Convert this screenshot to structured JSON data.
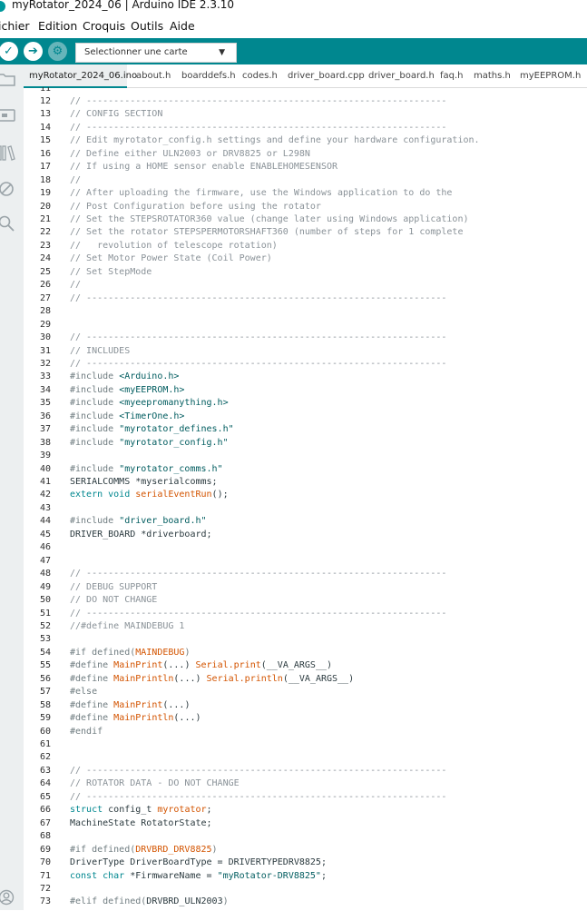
{
  "window": {
    "title": "myRotator_2024_06 | Arduino IDE 2.3.10"
  },
  "menu": {
    "items": [
      "ichier",
      "Edition",
      "Croquis",
      "Outils",
      "Aide"
    ]
  },
  "toolbar": {
    "verify_icon": "check-icon",
    "upload_icon": "arrow-right-icon",
    "debug_icon": "debug-icon",
    "board_select": "Selectionner une carte",
    "accent_color": "#00878f"
  },
  "sidebar": {
    "icons": [
      "folder-icon",
      "board-icon",
      "library-icon",
      "debug-disabled-icon",
      "search-icon",
      "user-icon"
    ]
  },
  "tabs": [
    "myRotator_2024_06.ino",
    "about.h",
    "boarddefs.h",
    "codes.h",
    "driver_board.cpp",
    "driver_board.h",
    "faq.h",
    "maths.h",
    "myEEPROM.h"
  ],
  "editor": {
    "lines": [
      {
        "n": "11",
        "seg": []
      },
      {
        "n": "12",
        "seg": [
          [
            "c",
            "// ------------------------------------------------------------------"
          ]
        ]
      },
      {
        "n": "13",
        "seg": [
          [
            "c",
            "// CONFIG SECTION"
          ]
        ]
      },
      {
        "n": "14",
        "seg": [
          [
            "c",
            "// ------------------------------------------------------------------"
          ]
        ]
      },
      {
        "n": "15",
        "seg": [
          [
            "c",
            "// Edit myrotator_config.h settings and define your hardware configuration."
          ]
        ]
      },
      {
        "n": "16",
        "seg": [
          [
            "c",
            "// Define either ULN2003 or DRV8825 or L298N"
          ]
        ]
      },
      {
        "n": "17",
        "seg": [
          [
            "c",
            "// If using a HOME sensor enable ENABLEHOMESENSOR"
          ]
        ]
      },
      {
        "n": "18",
        "seg": [
          [
            "c",
            "//"
          ]
        ]
      },
      {
        "n": "19",
        "seg": [
          [
            "c",
            "// After uploading the firmware, use the Windows application to do the"
          ]
        ]
      },
      {
        "n": "20",
        "seg": [
          [
            "c",
            "// Post Configuration before using the rotator"
          ]
        ]
      },
      {
        "n": "21",
        "seg": [
          [
            "c",
            "// Set the STEPSROTATOR360 value (change later using Windows application)"
          ]
        ]
      },
      {
        "n": "22",
        "seg": [
          [
            "c",
            "// Set the rotator STEPSPERMOTORSHAFT360 (number of steps for 1 complete"
          ]
        ]
      },
      {
        "n": "23",
        "seg": [
          [
            "c",
            "//   revolution of telescope rotation)"
          ]
        ]
      },
      {
        "n": "24",
        "seg": [
          [
            "c",
            "// Set Motor Power State (Coil Power)"
          ]
        ]
      },
      {
        "n": "25",
        "seg": [
          [
            "c",
            "// Set StepMode"
          ]
        ]
      },
      {
        "n": "26",
        "seg": [
          [
            "c",
            "//"
          ]
        ]
      },
      {
        "n": "27",
        "seg": [
          [
            "c",
            "// ------------------------------------------------------------------"
          ]
        ]
      },
      {
        "n": "28",
        "seg": []
      },
      {
        "n": "29",
        "seg": []
      },
      {
        "n": "30",
        "seg": [
          [
            "c",
            "// ------------------------------------------------------------------"
          ]
        ]
      },
      {
        "n": "31",
        "seg": [
          [
            "c",
            "// INCLUDES"
          ]
        ]
      },
      {
        "n": "32",
        "seg": [
          [
            "c",
            "// ------------------------------------------------------------------"
          ]
        ]
      },
      {
        "n": "33",
        "seg": [
          [
            "p",
            "#include "
          ],
          [
            "s",
            "<Arduino.h>"
          ]
        ]
      },
      {
        "n": "34",
        "seg": [
          [
            "p",
            "#include "
          ],
          [
            "s",
            "<myEEPROM.h>"
          ]
        ]
      },
      {
        "n": "35",
        "seg": [
          [
            "p",
            "#include "
          ],
          [
            "s",
            "<myeepromanything.h>"
          ]
        ]
      },
      {
        "n": "36",
        "seg": [
          [
            "p",
            "#include "
          ],
          [
            "s",
            "<TimerOne.h>"
          ]
        ]
      },
      {
        "n": "37",
        "seg": [
          [
            "p",
            "#include "
          ],
          [
            "s",
            "\"myrotator_defines.h\""
          ]
        ]
      },
      {
        "n": "38",
        "seg": [
          [
            "p",
            "#include "
          ],
          [
            "s",
            "\"myrotator_config.h\""
          ]
        ]
      },
      {
        "n": "39",
        "seg": []
      },
      {
        "n": "40",
        "seg": [
          [
            "p",
            "#include "
          ],
          [
            "s",
            "\"myrotator_comms.h\""
          ]
        ]
      },
      {
        "n": "41",
        "seg": [
          [
            "n",
            "SERIALCOMMS *myserialcomms;"
          ]
        ]
      },
      {
        "n": "42",
        "seg": [
          [
            "k",
            "extern void "
          ],
          [
            "f",
            "serialEventRun"
          ],
          [
            "n",
            "();"
          ]
        ]
      },
      {
        "n": "43",
        "seg": []
      },
      {
        "n": "44",
        "seg": [
          [
            "p",
            "#include "
          ],
          [
            "s",
            "\"driver_board.h\""
          ]
        ]
      },
      {
        "n": "45",
        "seg": [
          [
            "n",
            "DRIVER_BOARD *driverboard;"
          ]
        ]
      },
      {
        "n": "46",
        "seg": []
      },
      {
        "n": "47",
        "seg": []
      },
      {
        "n": "48",
        "seg": [
          [
            "c",
            "// ------------------------------------------------------------------"
          ]
        ]
      },
      {
        "n": "49",
        "seg": [
          [
            "c",
            "// DEBUG SUPPORT"
          ]
        ]
      },
      {
        "n": "50",
        "seg": [
          [
            "c",
            "// DO NOT CHANGE"
          ]
        ]
      },
      {
        "n": "51",
        "seg": [
          [
            "c",
            "// ------------------------------------------------------------------"
          ]
        ]
      },
      {
        "n": "52",
        "seg": [
          [
            "c",
            "//#define MAINDEBUG 1"
          ]
        ]
      },
      {
        "n": "53",
        "seg": []
      },
      {
        "n": "54",
        "seg": [
          [
            "p",
            "#if defined("
          ],
          [
            "f",
            "MAINDEBUG"
          ],
          [
            "p",
            ")"
          ]
        ]
      },
      {
        "n": "55",
        "seg": [
          [
            "p",
            "#define "
          ],
          [
            "f",
            "MainPrint"
          ],
          [
            "n",
            "(...) "
          ],
          [
            "f",
            "Serial.print"
          ],
          [
            "n",
            "(__VA_ARGS__)"
          ]
        ]
      },
      {
        "n": "56",
        "seg": [
          [
            "p",
            "#define "
          ],
          [
            "f",
            "MainPrintln"
          ],
          [
            "n",
            "(...) "
          ],
          [
            "f",
            "Serial.println"
          ],
          [
            "n",
            "(__VA_ARGS__)"
          ]
        ]
      },
      {
        "n": "57",
        "seg": [
          [
            "p",
            "#else"
          ]
        ]
      },
      {
        "n": "58",
        "seg": [
          [
            "p",
            "#define "
          ],
          [
            "f",
            "MainPrint"
          ],
          [
            "n",
            "(...)"
          ]
        ]
      },
      {
        "n": "59",
        "seg": [
          [
            "p",
            "#define "
          ],
          [
            "f",
            "MainPrintln"
          ],
          [
            "n",
            "(...)"
          ]
        ]
      },
      {
        "n": "60",
        "seg": [
          [
            "p",
            "#endif"
          ]
        ]
      },
      {
        "n": "61",
        "seg": []
      },
      {
        "n": "62",
        "seg": []
      },
      {
        "n": "63",
        "seg": [
          [
            "c",
            "// ------------------------------------------------------------------"
          ]
        ]
      },
      {
        "n": "64",
        "seg": [
          [
            "c",
            "// ROTATOR DATA - DO NOT CHANGE"
          ]
        ]
      },
      {
        "n": "65",
        "seg": [
          [
            "c",
            "// ------------------------------------------------------------------"
          ]
        ]
      },
      {
        "n": "66",
        "seg": [
          [
            "k",
            "struct "
          ],
          [
            "n",
            "config_t "
          ],
          [
            "f",
            "myrotator"
          ],
          [
            "n",
            ";"
          ]
        ]
      },
      {
        "n": "67",
        "seg": [
          [
            "n",
            "MachineState RotatorState;"
          ]
        ]
      },
      {
        "n": "68",
        "seg": []
      },
      {
        "n": "69",
        "seg": [
          [
            "p",
            "#if defined("
          ],
          [
            "f",
            "DRVBRD_DRV8825"
          ],
          [
            "p",
            ")"
          ]
        ]
      },
      {
        "n": "70",
        "seg": [
          [
            "n",
            "DriverType DriverBoardType = DRIVERTYPEDRV8825;"
          ]
        ]
      },
      {
        "n": "71",
        "seg": [
          [
            "k",
            "const char "
          ],
          [
            "n",
            "*FirmwareName = "
          ],
          [
            "s",
            "\"myRotator-DRV8825\""
          ],
          [
            "n",
            ";"
          ]
        ]
      },
      {
        "n": "72",
        "seg": []
      },
      {
        "n": "73",
        "seg": [
          [
            "p",
            "#elif defined("
          ],
          [
            "n",
            "DRVBRD_ULN2003"
          ],
          [
            "p",
            ")"
          ]
        ]
      }
    ]
  }
}
